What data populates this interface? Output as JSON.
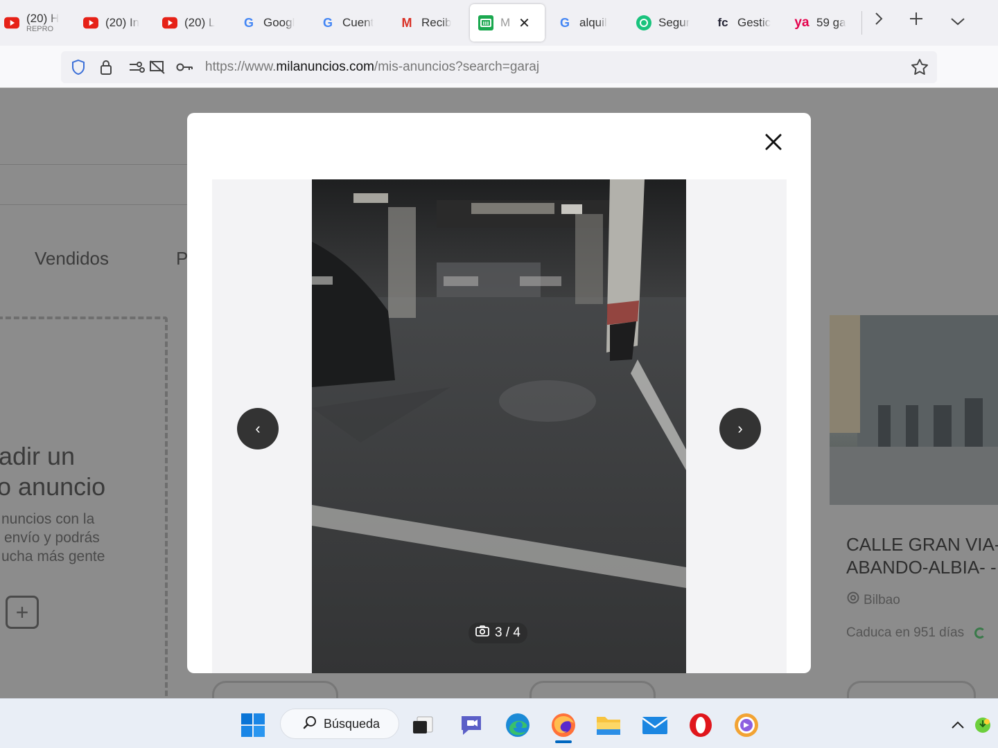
{
  "browser": {
    "tabs": [
      {
        "label": "(20) H",
        "sub": "REPRO",
        "icon": "youtube-icon"
      },
      {
        "label": "(20) In",
        "icon": "youtube-icon"
      },
      {
        "label": "(20) L",
        "icon": "youtube-icon"
      },
      {
        "label": "Googl",
        "icon": "google-icon"
      },
      {
        "label": "Cuent",
        "icon": "google-icon"
      },
      {
        "label": "Recib",
        "icon": "gmail-icon"
      },
      {
        "label": "M",
        "icon": "milanuncios-icon",
        "active": true
      },
      {
        "label": "alquil",
        "icon": "google-icon"
      },
      {
        "label": "Segur",
        "icon": "chatgpt-icon"
      },
      {
        "label": "Gestic",
        "icon": "fc-icon"
      },
      {
        "label": "59 ga",
        "icon": "yaencontre-icon"
      }
    ],
    "url": {
      "prefix": "https://www.",
      "domain": "milanuncios.com",
      "path": "/mis-anuncios?search=garaj"
    }
  },
  "page": {
    "tabs": {
      "sold": "Vendidos",
      "partial": "P"
    },
    "add_ad": {
      "line1": "adir un",
      "line2": "o anuncio",
      "desc1": "nuncios con la",
      "desc2": "envío y podrás",
      "desc3": "ucha más gente"
    },
    "card": {
      "title1": "CALLE GRAN VIA-",
      "title2": "ABANDO-ALBIA- -",
      "location": "Bilbao",
      "expires": "Caduca en 951 días"
    }
  },
  "modal": {
    "counter": "3 / 4",
    "prev_glyph": "‹",
    "next_glyph": "›"
  },
  "taskbar": {
    "search_label": "Búsqueda"
  }
}
